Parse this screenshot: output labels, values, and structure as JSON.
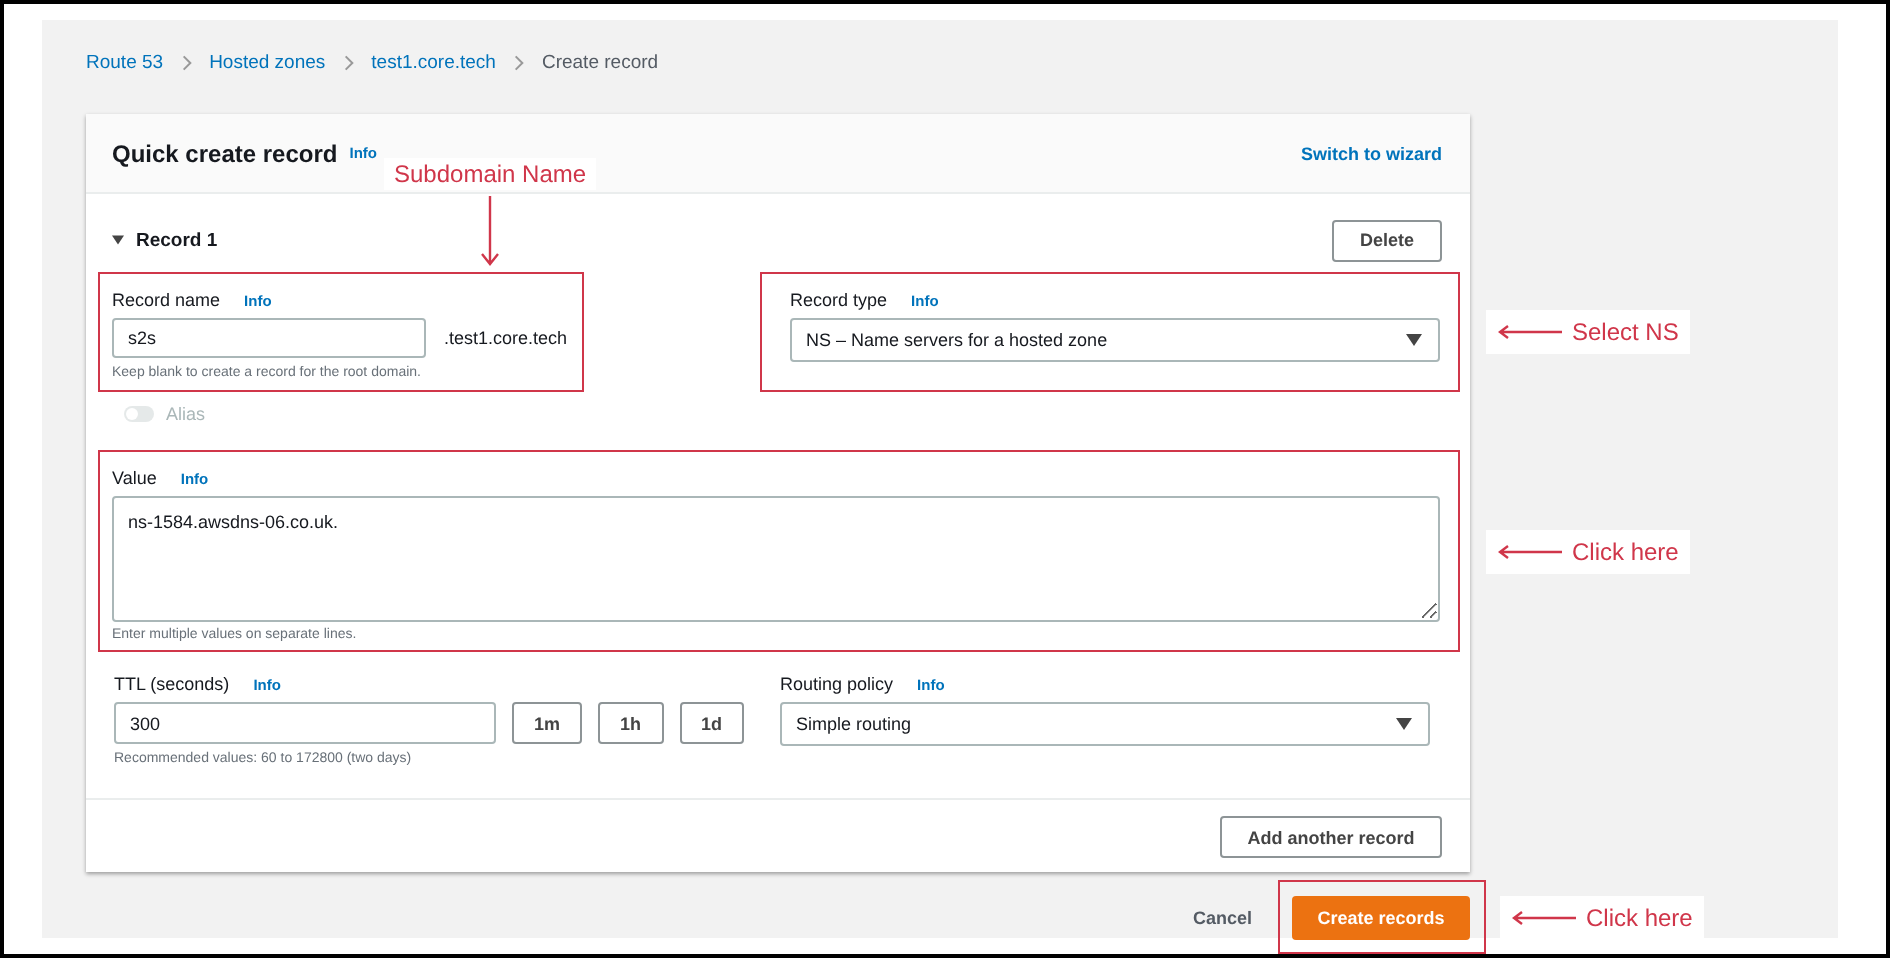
{
  "breadcrumb": [
    {
      "label": "Route 53",
      "link": true
    },
    {
      "label": "Hosted zones",
      "link": true
    },
    {
      "label": "test1.core.tech",
      "link": true
    },
    {
      "label": "Create record",
      "link": false
    }
  ],
  "header": {
    "title": "Quick create record",
    "info": "Info",
    "switch_link": "Switch to wizard"
  },
  "record": {
    "heading": "Record 1",
    "expanded": true,
    "delete_button": "Delete"
  },
  "record_name": {
    "label": "Record name",
    "info": "Info",
    "value": "s2s",
    "suffix": ".test1.core.tech",
    "hint": "Keep blank to create a record for the root domain.",
    "highlighted": true,
    "callout": "Subdomain Name"
  },
  "record_type": {
    "label": "Record type",
    "info": "Info",
    "value": "NS – Name servers for a hosted zone",
    "highlighted": true,
    "callout": "Select NS"
  },
  "alias": {
    "label": "Alias",
    "on": false,
    "disabled": true
  },
  "value": {
    "label": "Value",
    "info": "Info",
    "value": "ns-1584.awsdns-06.co.uk.",
    "hint": "Enter multiple values on separate lines.",
    "highlighted": true,
    "callout": "Click here"
  },
  "ttl": {
    "label": "TTL (seconds)",
    "info": "Info",
    "value": "300",
    "presets": [
      "1m",
      "1h",
      "1d"
    ],
    "hint": "Recommended values: 60 to 172800 (two days)"
  },
  "routing_policy": {
    "label": "Routing policy",
    "info": "Info",
    "value": "Simple routing"
  },
  "add_button": "Add another record",
  "actions": {
    "cancel": "Cancel",
    "submit": "Create records",
    "submit_highlighted": true,
    "callout": "Click here"
  }
}
